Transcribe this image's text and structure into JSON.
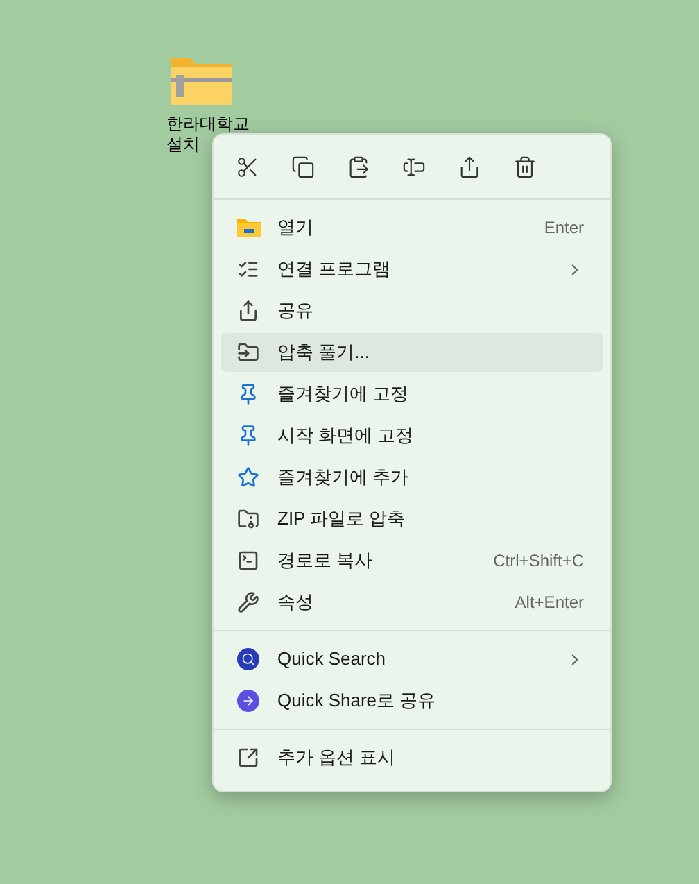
{
  "desktop_icon": {
    "label_lines": [
      "한라대학교",
      "설치"
    ]
  },
  "menu": {
    "groups": [
      [
        {
          "label": "열기",
          "shortcut": "Enter",
          "submenu": false,
          "selected": false
        },
        {
          "label": "연결 프로그램",
          "submenu": true,
          "selected": false
        },
        {
          "label": "공유",
          "submenu": false,
          "selected": false
        },
        {
          "label": "압축 풀기...",
          "submenu": false,
          "selected": true
        },
        {
          "label": "즐겨찾기에 고정",
          "submenu": false,
          "selected": false
        },
        {
          "label": "시작 화면에 고정",
          "submenu": false,
          "selected": false
        },
        {
          "label": "즐겨찾기에 추가",
          "submenu": false,
          "selected": false
        },
        {
          "label": "ZIP 파일로 압축",
          "submenu": false,
          "selected": false
        },
        {
          "label": "경로로 복사",
          "shortcut": "Ctrl+Shift+C",
          "submenu": false,
          "selected": false
        },
        {
          "label": "속성",
          "shortcut": "Alt+Enter",
          "submenu": false,
          "selected": false
        }
      ],
      [
        {
          "label": "Quick Search",
          "submenu": true,
          "selected": false
        },
        {
          "label": "Quick Share로 공유",
          "submenu": false,
          "selected": false
        }
      ],
      [
        {
          "label": "추가 옵션 표시",
          "submenu": false,
          "selected": false
        }
      ]
    ]
  }
}
